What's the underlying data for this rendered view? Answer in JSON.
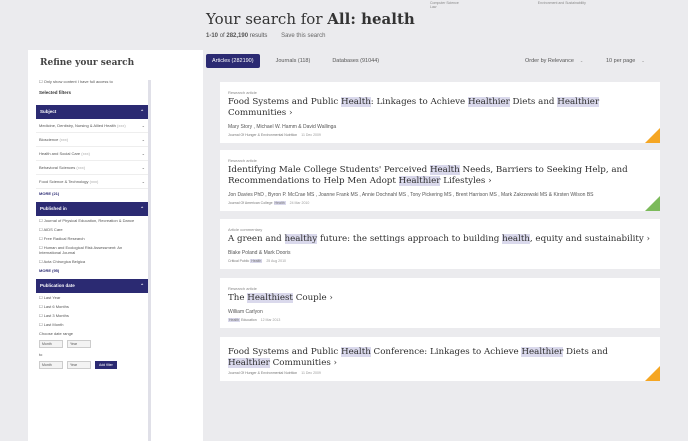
{
  "top_links": [
    "Computer Science",
    "Environment and Sustainability",
    "Law"
  ],
  "search": {
    "title_prefix": "Your search for",
    "query": "All: health",
    "range": "1-10",
    "of_word": "of",
    "total": "282,190",
    "results_word": "results",
    "save_label": "Save this search"
  },
  "sidebar": {
    "title": "Refine your search",
    "only_access": "Only show content I have full access to",
    "selected_filters": "Selected filters",
    "subject": {
      "label": "Subject",
      "items": [
        {
          "label": "Medicine, Dentistry, Nursing & Allied Health",
          "count": "(xxx)"
        },
        {
          "label": "Bioscience",
          "count": "(xxx)"
        },
        {
          "label": "Health and Social Care",
          "count": "(xxx)"
        },
        {
          "label": "Behavioral Sciences",
          "count": "(xxx)"
        },
        {
          "label": "Food Science & Technology",
          "count": "(xxx)"
        }
      ],
      "more": "MORE (21)"
    },
    "published": {
      "label": "Published in",
      "items": [
        "Journal of Physical Education, Recreation & Dance",
        "AIDS Care",
        "Free Radical Research",
        "Human and Ecological Risk Assessment: An International Journal",
        "Acta Chirurgica Belgica"
      ],
      "more": "MORE (95)"
    },
    "pubdate": {
      "label": "Publication date",
      "items": [
        "Last Year",
        "Last 6 Months",
        "Last 3 Months",
        "Last Month"
      ],
      "range_label": "Choose date range",
      "to": "to",
      "month": "Month",
      "year": "Year",
      "apply": "Add filter"
    }
  },
  "tabs": [
    {
      "label": "Articles (282190)"
    },
    {
      "label": "Journals (118)"
    },
    {
      "label": "Databases (91044)"
    }
  ],
  "sort": {
    "order": "Order by Relevance",
    "per_page": "10 per page"
  },
  "results": [
    {
      "type": "Research article",
      "title_parts": [
        [
          "Food Systems and Public ",
          false
        ],
        [
          "Health",
          true
        ],
        [
          ": Linkages to Achieve ",
          false
        ],
        [
          "Healthier",
          true
        ],
        [
          " Diets and ",
          false
        ],
        [
          "Healthier",
          true
        ],
        [
          " Communities",
          false
        ]
      ],
      "authors": "Mary Story , Michael W. Hamm & David Wallinga",
      "journal_parts": [
        [
          "Journal Of Hunger & Environmental Nutrition",
          false
        ]
      ],
      "date": "11 Dec 2009",
      "corner": "orange"
    },
    {
      "type": "Research article",
      "title_parts": [
        [
          "Identifying Male College Students' Perceived ",
          false
        ],
        [
          "Health",
          true
        ],
        [
          " Needs, Barriers to Seeking Help, and Recommendations to Help Men Adopt ",
          false
        ],
        [
          "Healthier",
          true
        ],
        [
          " Lifestyles",
          false
        ]
      ],
      "authors": "Jon Davies PhD , Byron P. McCrae MS , Joanne Frank MS , Annie Dochnahl MS , Tony Pickering MS , Brent Harrison MS , Mark Zakrzewski MS & Kirsten Wilson BS",
      "journal_parts": [
        [
          "Journal Of American College ",
          false
        ],
        [
          "Health",
          true
        ]
      ],
      "date": "24 Mar 2010",
      "corner": "green"
    },
    {
      "type": "Article commentary",
      "title_parts": [
        [
          "A green and ",
          false
        ],
        [
          "healthy",
          true
        ],
        [
          " future: the settings approach to building ",
          false
        ],
        [
          "health",
          true
        ],
        [
          ", equity and sustainability",
          false
        ]
      ],
      "authors": "Blake Poland & Mark Dooris",
      "journal_parts": [
        [
          "Critical Public ",
          false
        ],
        [
          "Health",
          true
        ]
      ],
      "date": "25 Aug 2010",
      "corner": ""
    },
    {
      "type": "Research article",
      "title_parts": [
        [
          "The ",
          false
        ],
        [
          "Healthiest",
          true
        ],
        [
          " Couple",
          false
        ]
      ],
      "authors": "William Carlyon",
      "journal_parts": [
        [
          "Health",
          true
        ],
        [
          " Education",
          false
        ]
      ],
      "date": "12 Mar 2013",
      "corner": ""
    },
    {
      "type": "",
      "title_parts": [
        [
          "Food Systems and Public ",
          false
        ],
        [
          "Health",
          true
        ],
        [
          " Conference: Linkages to Achieve ",
          false
        ],
        [
          "Healthier",
          true
        ],
        [
          " Diets and ",
          false
        ],
        [
          "Healthier",
          true
        ],
        [
          " Communities",
          false
        ]
      ],
      "authors": "",
      "journal_parts": [
        [
          "Journal Of Hunger & Environmental Nutrition",
          false
        ]
      ],
      "date": "11 Dec 2009",
      "corner": "orange"
    }
  ],
  "colors": {
    "brand": "#2b2a72",
    "highlight": "#dad9ec",
    "open_access": "#f5a623",
    "free_access": "#7cba5b"
  }
}
